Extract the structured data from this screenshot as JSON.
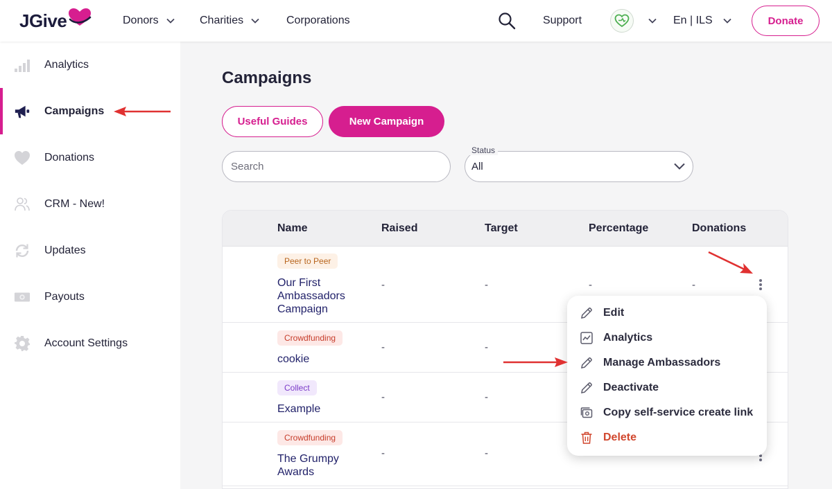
{
  "header": {
    "logo_text": "JGive",
    "nav": [
      {
        "label": "Donors"
      },
      {
        "label": "Charities"
      },
      {
        "label": "Corporations"
      }
    ],
    "support_label": "Support",
    "language_label": "En | ILS",
    "donate_label": "Donate"
  },
  "sidebar": {
    "items": [
      {
        "label": "Analytics",
        "icon": "bar-chart-icon"
      },
      {
        "label": "Campaigns",
        "icon": "megaphone-icon",
        "active": true
      },
      {
        "label": "Donations",
        "icon": "heart-icon"
      },
      {
        "label": "CRM - New!",
        "icon": "people-icon"
      },
      {
        "label": "Updates",
        "icon": "refresh-icon"
      },
      {
        "label": "Payouts",
        "icon": "banknote-icon"
      },
      {
        "label": "Account Settings",
        "icon": "gear-icon"
      }
    ]
  },
  "main": {
    "title": "Campaigns",
    "useful_guides_label": "Useful Guides",
    "new_campaign_label": "New Campaign",
    "search_placeholder": "Search",
    "status_label": "Status",
    "status_value": "All"
  },
  "table": {
    "columns": [
      "Name",
      "Raised",
      "Target",
      "Percentage",
      "Donations"
    ],
    "rows": [
      {
        "tag": "Peer to Peer",
        "name": "Our First Ambassadors Campaign",
        "raised": "-",
        "target": "-",
        "percentage": "-",
        "donations": "-"
      },
      {
        "tag": "Crowdfunding",
        "name": "cookie",
        "raised": "-",
        "target": "-"
      },
      {
        "tag": "Collect",
        "name": "Example",
        "raised": "-",
        "target": "-"
      },
      {
        "tag": "Crowdfunding",
        "name": "The Grumpy Awards",
        "raised": "-",
        "target": "-"
      }
    ]
  },
  "row_menu": {
    "items": [
      {
        "label": "Edit",
        "icon": "pencil-icon"
      },
      {
        "label": "Analytics",
        "icon": "line-chart-icon"
      },
      {
        "label": "Manage Ambassadors",
        "icon": "pencil-icon"
      },
      {
        "label": "Deactivate",
        "icon": "pencil-icon"
      },
      {
        "label": "Copy self-service create link",
        "icon": "copy-link-icon"
      },
      {
        "label": "Delete",
        "icon": "trash-icon"
      }
    ]
  },
  "colors": {
    "brand": "#d61e8f",
    "danger": "#d1472e",
    "annotation": "#e03131"
  }
}
